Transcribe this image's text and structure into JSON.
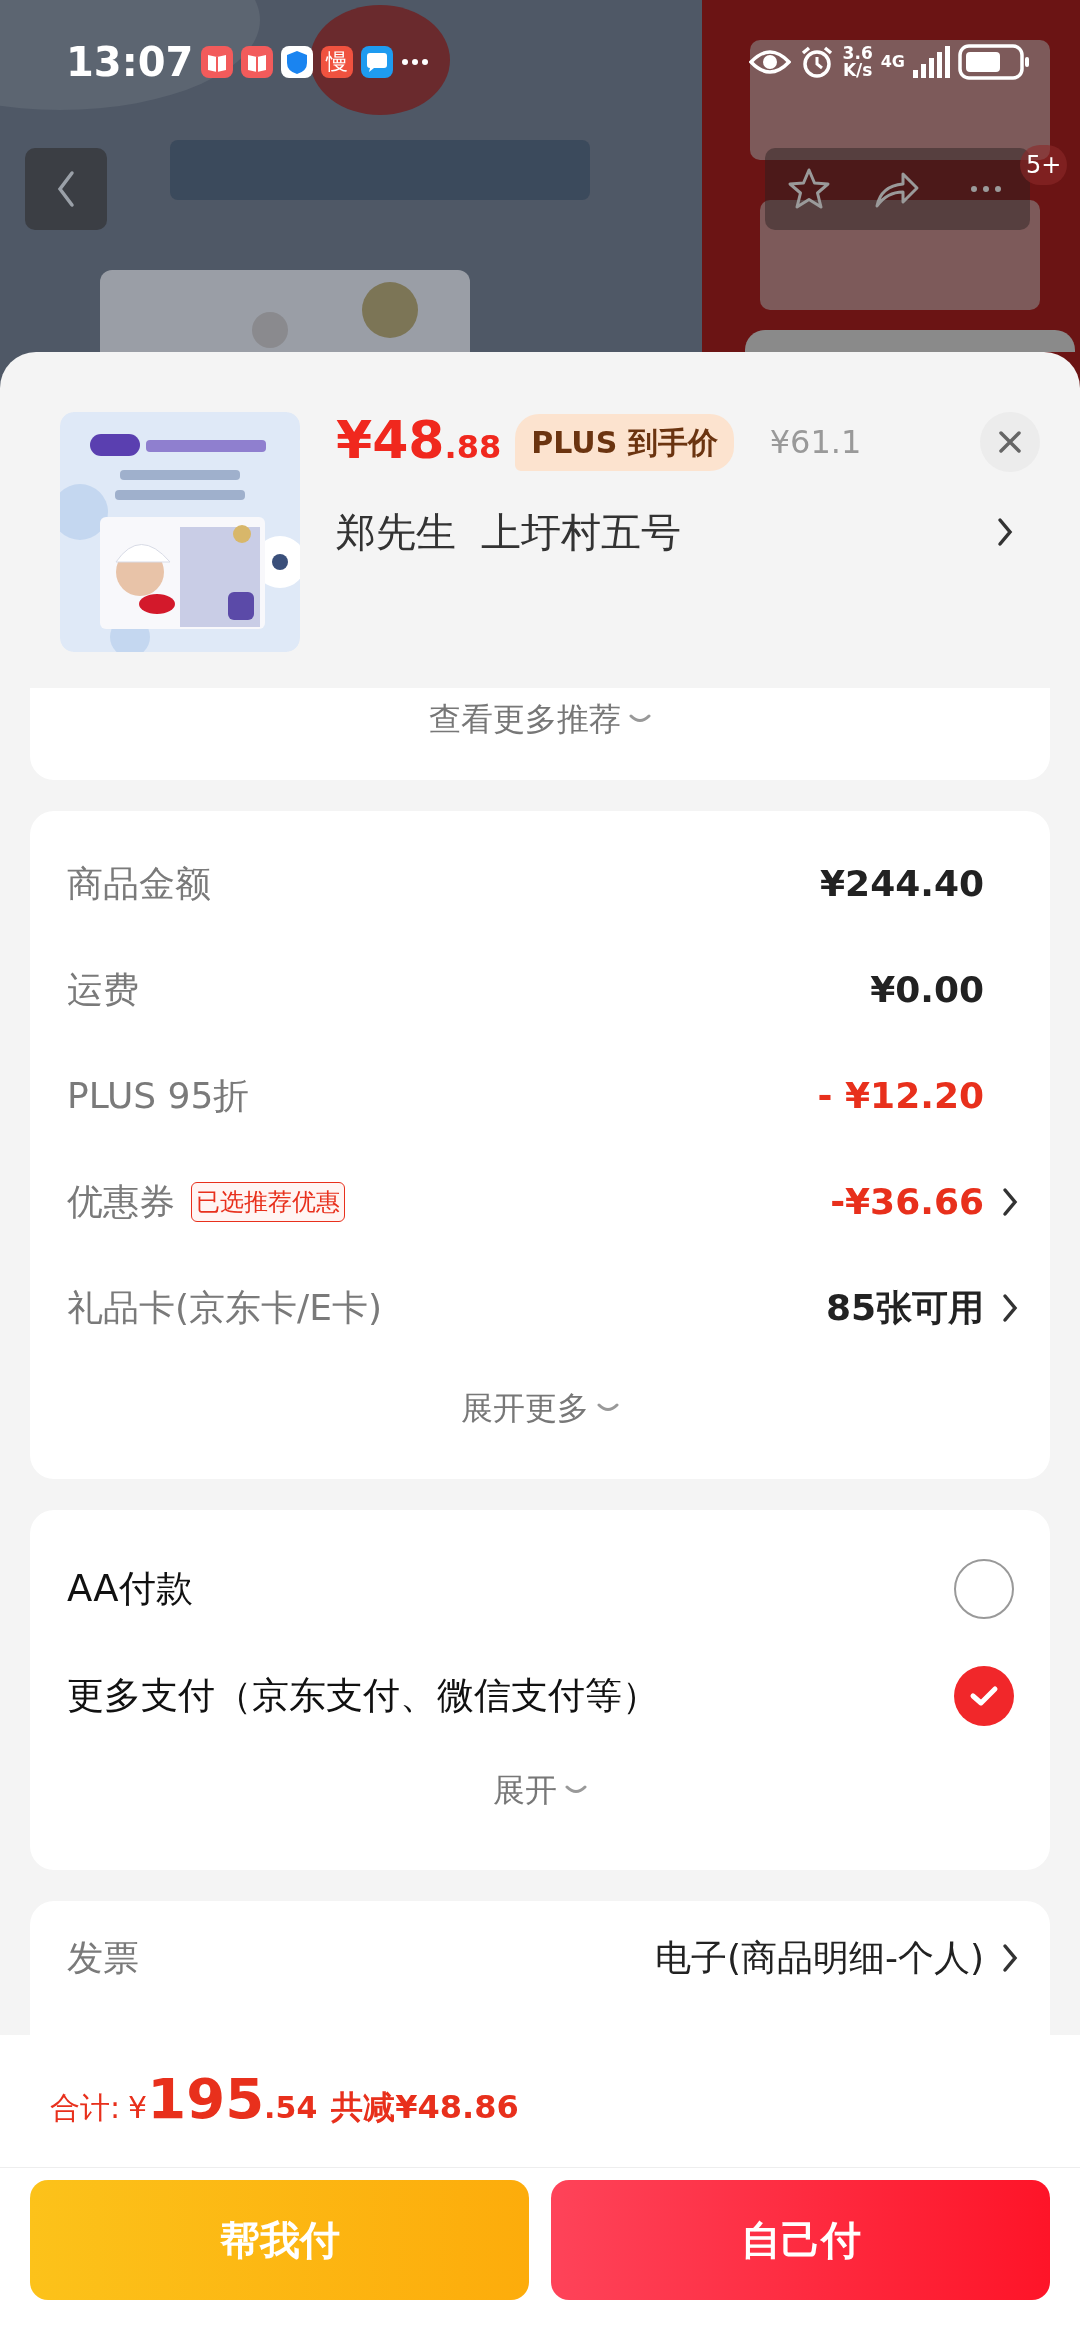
{
  "status_bar": {
    "time": "13:07",
    "app_icon_text": "慢",
    "network_speed": "3.6",
    "speed_unit": "K/s",
    "network_type": "4G"
  },
  "header": {
    "badge": "5+"
  },
  "product": {
    "price_main": "¥48",
    "price_decimal": ".88",
    "price_tag": "PLUS 到手价",
    "original_price": "¥61.1",
    "address": "郑先生  上圩村五号"
  },
  "recommend": {
    "label": "查看更多推荐"
  },
  "summary": {
    "rows": [
      {
        "label": "商品金额",
        "value": "¥244.40",
        "deduction": false,
        "chevron": false
      },
      {
        "label": "运费",
        "value": "¥0.00",
        "deduction": false,
        "chevron": false
      },
      {
        "label": "PLUS 95折",
        "value": "- ¥12.20",
        "deduction": true,
        "chevron": false
      },
      {
        "label": "优惠券",
        "tag": "已选推荐优惠",
        "value": "-¥36.66",
        "deduction": true,
        "chevron": true
      },
      {
        "label": "礼品卡(京东卡/E卡)",
        "value": "85张可用",
        "deduction": false,
        "chevron": true
      }
    ],
    "expand": "展开更多"
  },
  "payment": {
    "options": [
      {
        "label": "AA付款",
        "selected": false
      },
      {
        "label": "更多支付（京东支付、微信支付等）",
        "selected": true
      }
    ],
    "expand": "展开"
  },
  "invoice": {
    "label": "发票",
    "value": "电子(商品明细-个人)"
  },
  "footer": {
    "total_label": "合计:",
    "currency": "¥",
    "total_int": "195",
    "total_dec": ".54",
    "discount": "共减¥48.86",
    "buttons": [
      {
        "label": "帮我付",
        "kind": "secondary"
      },
      {
        "label": "自己付",
        "kind": "primary"
      }
    ]
  }
}
